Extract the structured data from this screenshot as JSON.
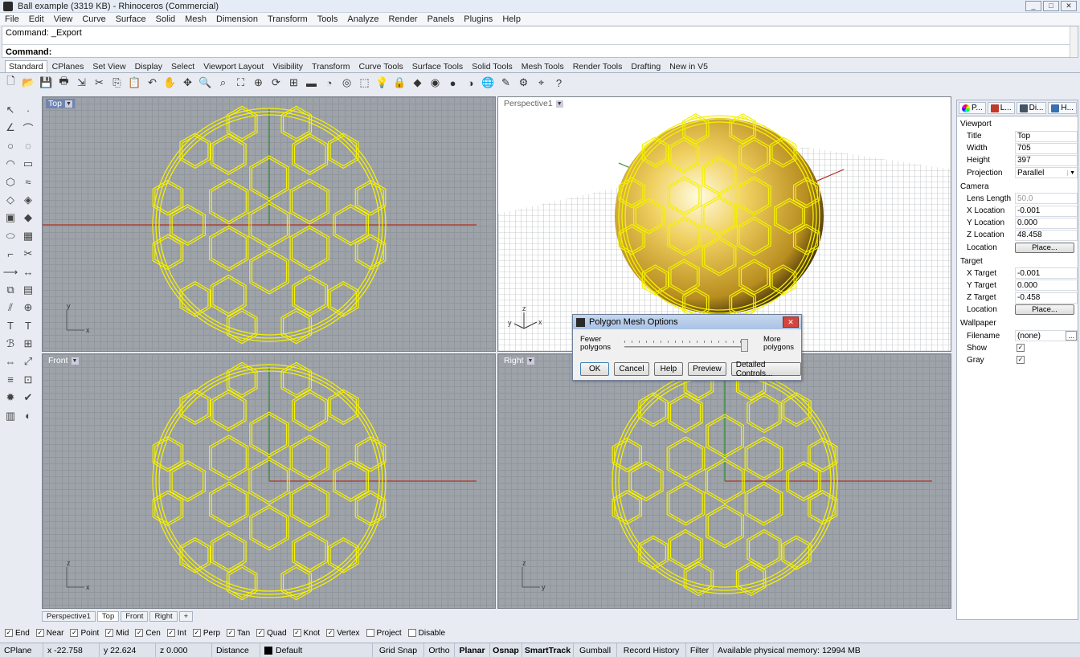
{
  "window": {
    "title": "Ball example (3319 KB) - Rhinoceros (Commercial)",
    "controls": [
      "_",
      "□",
      "✕"
    ]
  },
  "menu": [
    "File",
    "Edit",
    "View",
    "Curve",
    "Surface",
    "Solid",
    "Mesh",
    "Dimension",
    "Transform",
    "Tools",
    "Analyze",
    "Render",
    "Panels",
    "Plugins",
    "Help"
  ],
  "command": {
    "history": "Command: _Export",
    "prompt": "Command:"
  },
  "tabs": [
    "Standard",
    "CPlanes",
    "Set View",
    "Display",
    "Select",
    "Viewport Layout",
    "Visibility",
    "Transform",
    "Curve Tools",
    "Surface Tools",
    "Solid Tools",
    "Mesh Tools",
    "Render Tools",
    "Drafting",
    "New in V5"
  ],
  "viewports": {
    "top": {
      "label": "Top"
    },
    "perspective": {
      "label": "Perspective1"
    },
    "front": {
      "label": "Front"
    },
    "right": {
      "label": "Right"
    }
  },
  "axes": {
    "x": "x",
    "y": "y",
    "z": "z"
  },
  "viewport_tabs": [
    "Perspective1",
    "Top",
    "Front",
    "Right",
    "+"
  ],
  "dialog": {
    "title": "Polygon Mesh Options",
    "fewer": "Fewer polygons",
    "more": "More polygons",
    "slider_level": 0.96,
    "buttons": [
      "OK",
      "Cancel",
      "Help",
      "Preview",
      "Detailed Controls..."
    ]
  },
  "properties": {
    "tabs": [
      "P...",
      "L...",
      "Di...",
      "H..."
    ],
    "sections": [
      {
        "title": "Viewport",
        "rows": [
          {
            "key": "Title",
            "value": "Top"
          },
          {
            "key": "Width",
            "value": "705"
          },
          {
            "key": "Height",
            "value": "397"
          },
          {
            "key": "Projection",
            "value": "Parallel"
          }
        ]
      },
      {
        "title": "Camera",
        "rows": [
          {
            "key": "Lens Length",
            "value": "50.0"
          },
          {
            "key": "X Location",
            "value": "-0.001"
          },
          {
            "key": "Y Location",
            "value": "0.000"
          },
          {
            "key": "Z Location",
            "value": "48.458"
          },
          {
            "key": "Location",
            "value": "Place..."
          }
        ]
      },
      {
        "title": "Target",
        "rows": [
          {
            "key": "X Target",
            "value": "-0.001"
          },
          {
            "key": "Y Target",
            "value": "0.000"
          },
          {
            "key": "Z Target",
            "value": "-0.458"
          },
          {
            "key": "Location",
            "value": "Place..."
          }
        ]
      },
      {
        "title": "Wallpaper",
        "rows": [
          {
            "key": "Filename",
            "value": "(none)"
          },
          {
            "key": "Show",
            "value": "✓"
          },
          {
            "key": "Gray",
            "value": "✓"
          }
        ]
      }
    ]
  },
  "osnaps": [
    {
      "label": "End",
      "checked": true
    },
    {
      "label": "Near",
      "checked": true
    },
    {
      "label": "Point",
      "checked": true
    },
    {
      "label": "Mid",
      "checked": true
    },
    {
      "label": "Cen",
      "checked": true
    },
    {
      "label": "Int",
      "checked": true
    },
    {
      "label": "Perp",
      "checked": true
    },
    {
      "label": "Tan",
      "checked": true
    },
    {
      "label": "Quad",
      "checked": true
    },
    {
      "label": "Knot",
      "checked": true
    },
    {
      "label": "Vertex",
      "checked": true
    },
    {
      "label": "Project",
      "checked": false
    },
    {
      "label": "Disable",
      "checked": false
    }
  ],
  "status": {
    "cplane": "CPlane",
    "x": "x -22.758",
    "y": "y 22.624",
    "z": "z 0.000",
    "distance": "Distance",
    "layer": "Default",
    "grid_snap": "Grid Snap",
    "ortho": "Ortho",
    "planar": "Planar",
    "osnap": "Osnap",
    "smarttrack": "SmartTrack",
    "gumball": "Gumball",
    "record_history": "Record History",
    "filter": "Filter",
    "memory": "Available physical memory: 12994 MB"
  },
  "colors": {
    "wire": "#f4f000",
    "x_axis": "#b03020",
    "y_axis": "#2a8a2a",
    "viewport_bg": "#9ea3aa",
    "sphere": "#e8c84a"
  }
}
